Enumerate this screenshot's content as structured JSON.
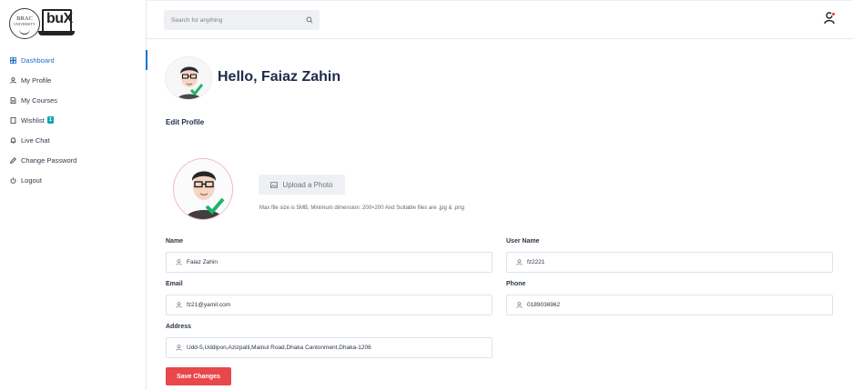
{
  "brand": {
    "university_name": "BRAC",
    "university_sub": "UNIVERSITY",
    "platform_name": "buX"
  },
  "sidebar": {
    "items": [
      {
        "label": "Dashboard",
        "icon": "dashboard-icon",
        "active": true
      },
      {
        "label": "My Profile",
        "icon": "user-icon"
      },
      {
        "label": "My Courses",
        "icon": "document-icon"
      },
      {
        "label": "Wishlist",
        "icon": "bookmark-icon",
        "badge": "1"
      },
      {
        "label": "Live Chat",
        "icon": "bell-icon"
      },
      {
        "label": "Change Password",
        "icon": "edit-icon"
      },
      {
        "label": "Logout",
        "icon": "power-icon"
      }
    ]
  },
  "header": {
    "search_placeholder": "Search for anything",
    "search_icon": "search-icon",
    "profile_icon": "user-icon",
    "notification_color": "#e53935"
  },
  "main": {
    "greeting": "Hello, Faiaz Zahin",
    "section_title": "Edit Profile",
    "upload_label": "Upload a Photo",
    "upload_hint": "Max file size is 5MB, Minimum dimension: 200×200 And Suitable files are .jpg & .png",
    "fields": {
      "name": {
        "label": "Name",
        "value": "Faiaz Zahin"
      },
      "username": {
        "label": "User Name",
        "value": "fz2221"
      },
      "email": {
        "label": "Email",
        "value": "fz21@yamil.com"
      },
      "phone": {
        "label": "Phone",
        "value": "0189036962"
      },
      "address": {
        "label": "Address",
        "value": "Udd-5,Uddipon,Azizpalli,Mainul Road,Dhaka Cantonment,Dhaka-1206"
      }
    },
    "save_label": "Save Changes"
  },
  "colors": {
    "accent": "#1a73c8",
    "danger": "#e8474c",
    "badge": "#17a2b8",
    "heading": "#1c2b4a"
  }
}
